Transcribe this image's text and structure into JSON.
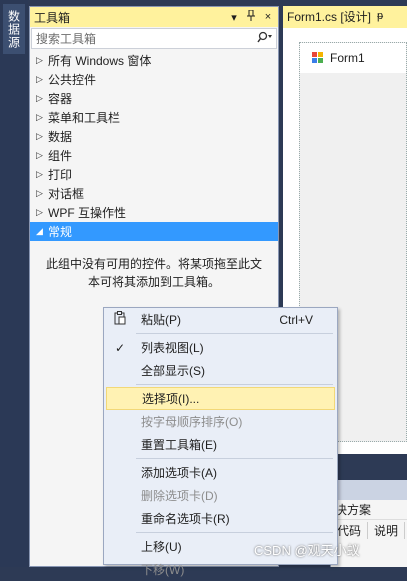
{
  "side_tab": {
    "label": "数据源"
  },
  "toolbox": {
    "title": "工具箱",
    "pin_icon": "▾ ᵽ",
    "close_icon": "×",
    "search_placeholder": "搜索工具箱",
    "search_icon_glyph": "ᵽ▾",
    "groups": [
      {
        "label": "所有 Windows 窗体",
        "expanded": false
      },
      {
        "label": "公共控件",
        "expanded": false
      },
      {
        "label": "容器",
        "expanded": false
      },
      {
        "label": "菜单和工具栏",
        "expanded": false
      },
      {
        "label": "数据",
        "expanded": false
      },
      {
        "label": "组件",
        "expanded": false
      },
      {
        "label": "打印",
        "expanded": false
      },
      {
        "label": "对话框",
        "expanded": false
      },
      {
        "label": "WPF 互操作性",
        "expanded": false
      },
      {
        "label": "常规",
        "expanded": true,
        "selected": true
      }
    ],
    "empty_message_line1": "此组中没有可用的控件。将某项拖至此文",
    "empty_message_line2": "本可将其添加到工具箱。"
  },
  "document": {
    "tab_label": "Form1.cs [设计]",
    "tab_pin": "ᵽ",
    "form_title": "Form1"
  },
  "bottom_panel": {
    "row1": "决方案",
    "col1": "代码",
    "col2": "说明"
  },
  "context_menu": {
    "items": [
      {
        "label": "粘贴(P)",
        "shortcut": "Ctrl+V",
        "icon": "paste-icon",
        "disabled": false
      },
      {
        "separator": true
      },
      {
        "label": "列表视图(L)",
        "checked": true,
        "disabled": false
      },
      {
        "label": "全部显示(S)",
        "disabled": false
      },
      {
        "separator": true
      },
      {
        "label": "选择项(I)...",
        "disabled": false,
        "hover": true
      },
      {
        "label": "按字母顺序排序(O)",
        "disabled": true
      },
      {
        "label": "重置工具箱(E)",
        "disabled": false
      },
      {
        "separator": true
      },
      {
        "label": "添加选项卡(A)",
        "disabled": false
      },
      {
        "label": "删除选项卡(D)",
        "disabled": true
      },
      {
        "label": "重命名选项卡(R)",
        "disabled": false
      },
      {
        "separator": true
      },
      {
        "label": "上移(U)",
        "disabled": false
      },
      {
        "label": "下移(W)",
        "disabled": true
      }
    ]
  },
  "watermark": "CSDN @观天小蚁",
  "colors": {
    "title_active": "#fff29d",
    "selection": "#3399ff",
    "menu_bg": "#e9eef7",
    "menu_hover": "#fff2b3",
    "frame_dark": "#2b3956"
  }
}
